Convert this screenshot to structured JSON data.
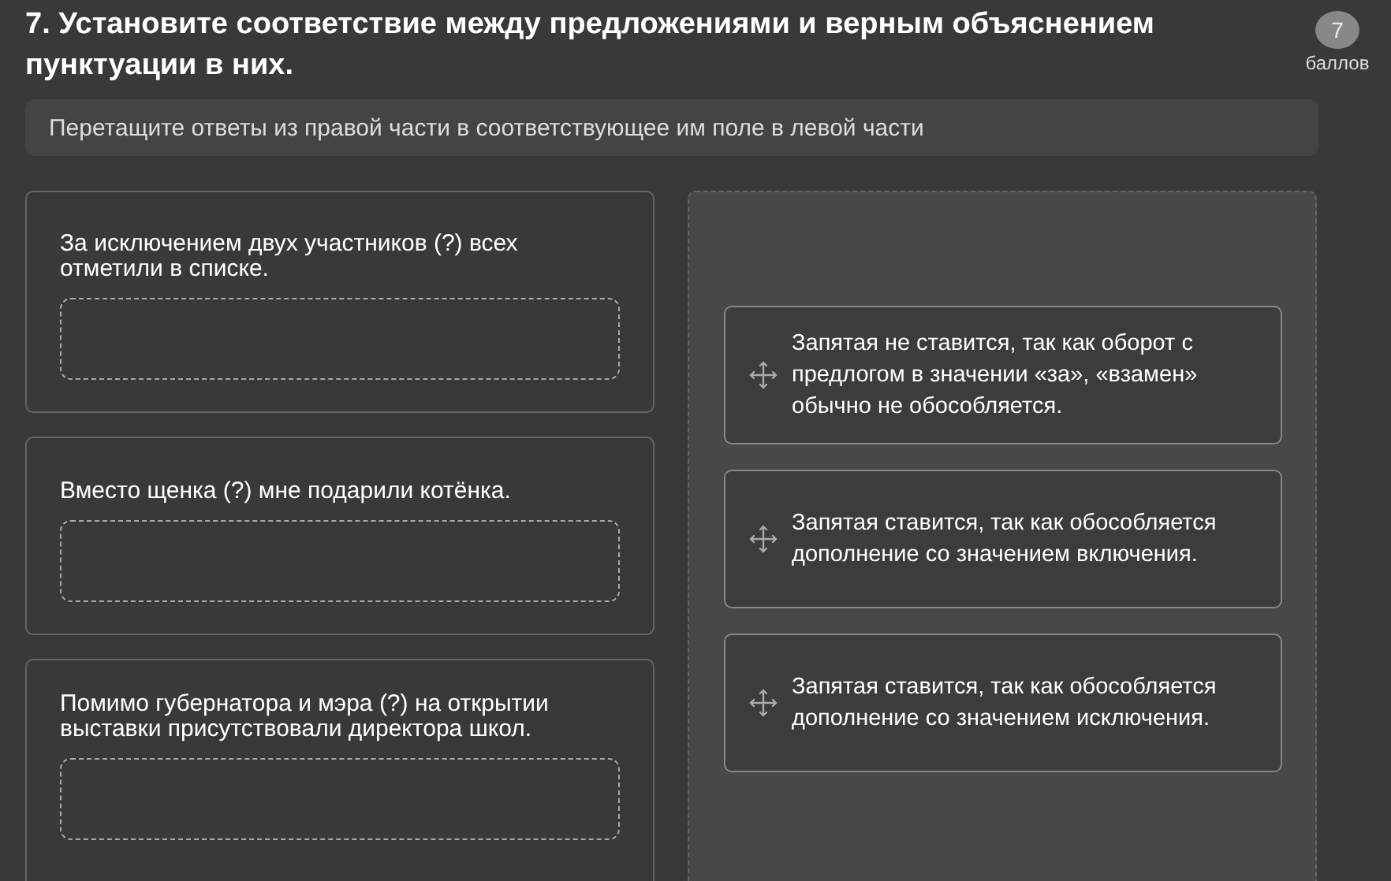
{
  "question": {
    "title": "7. Установите соответствие между предложениями и верным объяснением пунктуации в них.",
    "points": "7",
    "points_label": "баллов"
  },
  "instruction": "Перетащите ответы из правой части в соответствующее им поле в левой части",
  "sentences": [
    {
      "text": "За исключением двух участников (?) всех отметили в списке."
    },
    {
      "text": "Вместо щенка (?) мне подарили котёнка."
    },
    {
      "text": "Помимо губернатора и мэра (?) на открытии выставки присутствовали директора школ."
    }
  ],
  "answers": [
    {
      "text": "Запятая не ставится, так как оборот с предлогом в значении «за», «взамен» обычно не обособляется."
    },
    {
      "text": "Запятая ставится, так как обособляется дополнение со значением включения."
    },
    {
      "text": "Запятая ставится, так как обособляется дополнение со значением исключения."
    }
  ]
}
